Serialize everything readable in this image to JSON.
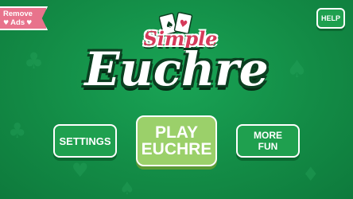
{
  "remove_ads": {
    "line1": "Remove",
    "line2": "Ads"
  },
  "help": {
    "label": "HELP"
  },
  "logo": {
    "subtitle": "Simple",
    "title": "Euchre"
  },
  "buttons": {
    "settings": "SETTINGS",
    "play_line1": "PLAY",
    "play_line2": "EUCHRE",
    "more_line1": "MORE",
    "more_line2": "FUN"
  },
  "colors": {
    "background": "#138c46",
    "button": "#1fa04f",
    "play_button": "#9bd06a",
    "ribbon": "#e8738c",
    "logo_accent": "#d63a5a"
  },
  "icons": [
    "heart-icon",
    "playing-cards-icon",
    "club-suit-icon"
  ]
}
